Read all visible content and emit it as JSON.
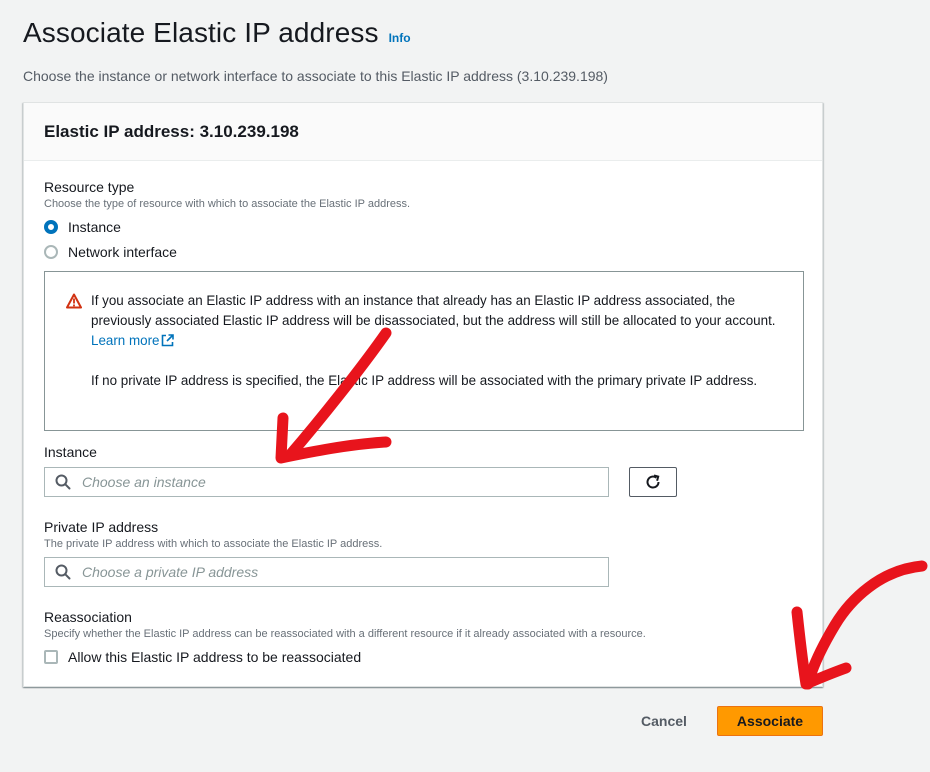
{
  "header": {
    "title": "Associate Elastic IP address",
    "info_label": "Info",
    "description": "Choose the instance or network interface to associate to this Elastic IP address (3.10.239.198)"
  },
  "panel": {
    "title": "Elastic IP address: 3.10.239.198",
    "resource_type": {
      "label": "Resource type",
      "description": "Choose the type of resource with which to associate the Elastic IP address.",
      "options": [
        {
          "label": "Instance",
          "selected": true
        },
        {
          "label": "Network interface",
          "selected": false
        }
      ]
    },
    "alert": {
      "icon": "warning-triangle-icon",
      "text1": "If you associate an Elastic IP address with an instance that already has an Elastic IP address associated, the previously associated Elastic IP address will be disassociated, but the address will still be allocated to your account.",
      "learn_more": "Learn more",
      "text2": "If no private IP address is specified, the Elastic IP address will be associated with the primary private IP address."
    },
    "instance": {
      "label": "Instance",
      "placeholder": "Choose an instance"
    },
    "private_ip": {
      "label": "Private IP address",
      "description": "The private IP address with which to associate the Elastic IP address.",
      "placeholder": "Choose a private IP address"
    },
    "reassociation": {
      "label": "Reassociation",
      "description": "Specify whether the Elastic IP address can be reassociated with a different resource if it already associated with a resource.",
      "checkbox_label": "Allow this Elastic IP address to be reassociated",
      "checked": false
    }
  },
  "footer": {
    "cancel_label": "Cancel",
    "associate_label": "Associate"
  },
  "colors": {
    "link": "#0073bb",
    "primary_button": "#ff9900",
    "warning": "#d13212",
    "annotation_arrow": "#e8141c"
  }
}
